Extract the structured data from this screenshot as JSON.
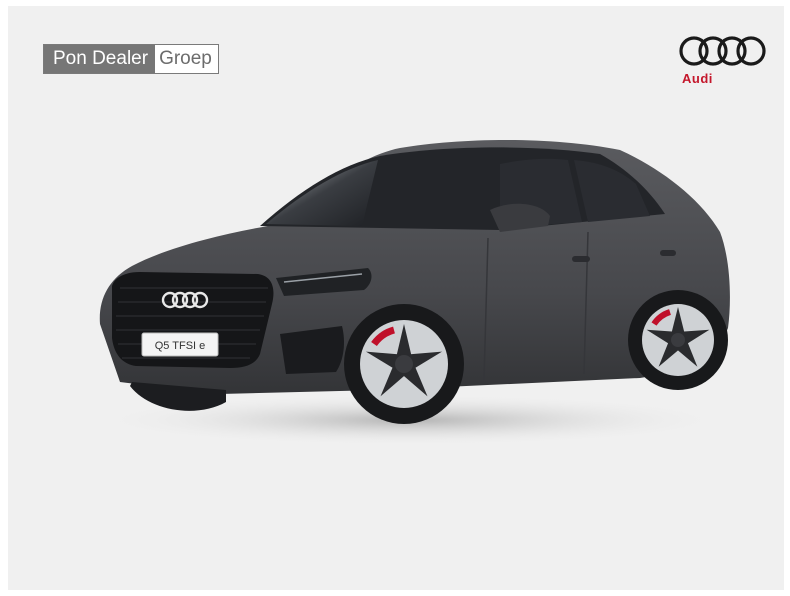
{
  "dealer_logo": {
    "part1": "Pon Dealer",
    "part2": "Groep"
  },
  "brand": {
    "name": "Audi",
    "color": "#c4172c"
  },
  "vehicle": {
    "plate_text": "Q5 TFSI e",
    "color": "#4a4b4e"
  }
}
